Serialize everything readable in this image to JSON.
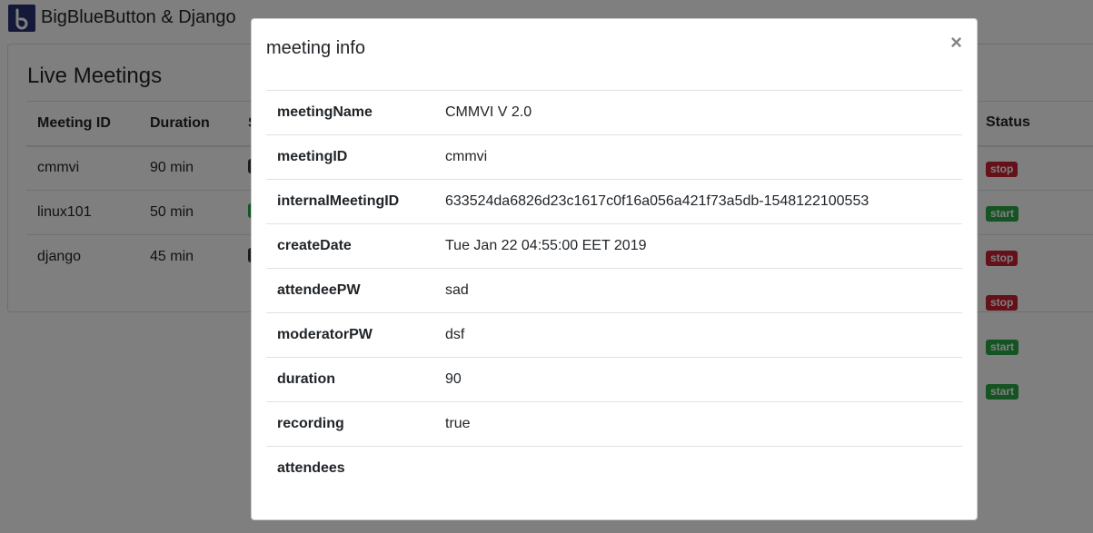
{
  "navbar": {
    "brand": "BigBlueButton & Django"
  },
  "page": {
    "title": "Live Meetings",
    "columns": {
      "id": "Meeting ID",
      "duration": "Duration",
      "third": "S",
      "status": "Status"
    },
    "rows": [
      {
        "id": "cmmvi",
        "duration": "90 min"
      },
      {
        "id": "linux101",
        "duration": "50 min"
      },
      {
        "id": "django",
        "duration": "45 min"
      }
    ],
    "statuses": [
      "stop",
      "start",
      "stop",
      "stop",
      "start",
      "start"
    ]
  },
  "colors": {
    "stop": "#c82333",
    "start": "#28a745",
    "dark": "#343a40",
    "logo": "#283274"
  },
  "modal": {
    "title": "meeting info",
    "close": "×",
    "fields": [
      {
        "key": "meetingName",
        "value": "CMMVI V 2.0"
      },
      {
        "key": "meetingID",
        "value": "cmmvi"
      },
      {
        "key": "internalMeetingID",
        "value": "633524da6826d23c1617c0f16a056a421f73a5db-1548122100553"
      },
      {
        "key": "createDate",
        "value": "Tue Jan 22 04:55:00 EET 2019"
      },
      {
        "key": "attendeePW",
        "value": "sad"
      },
      {
        "key": "moderatorPW",
        "value": "dsf"
      },
      {
        "key": "duration",
        "value": "90"
      },
      {
        "key": "recording",
        "value": "true"
      },
      {
        "key": "attendees",
        "value": ""
      }
    ]
  }
}
